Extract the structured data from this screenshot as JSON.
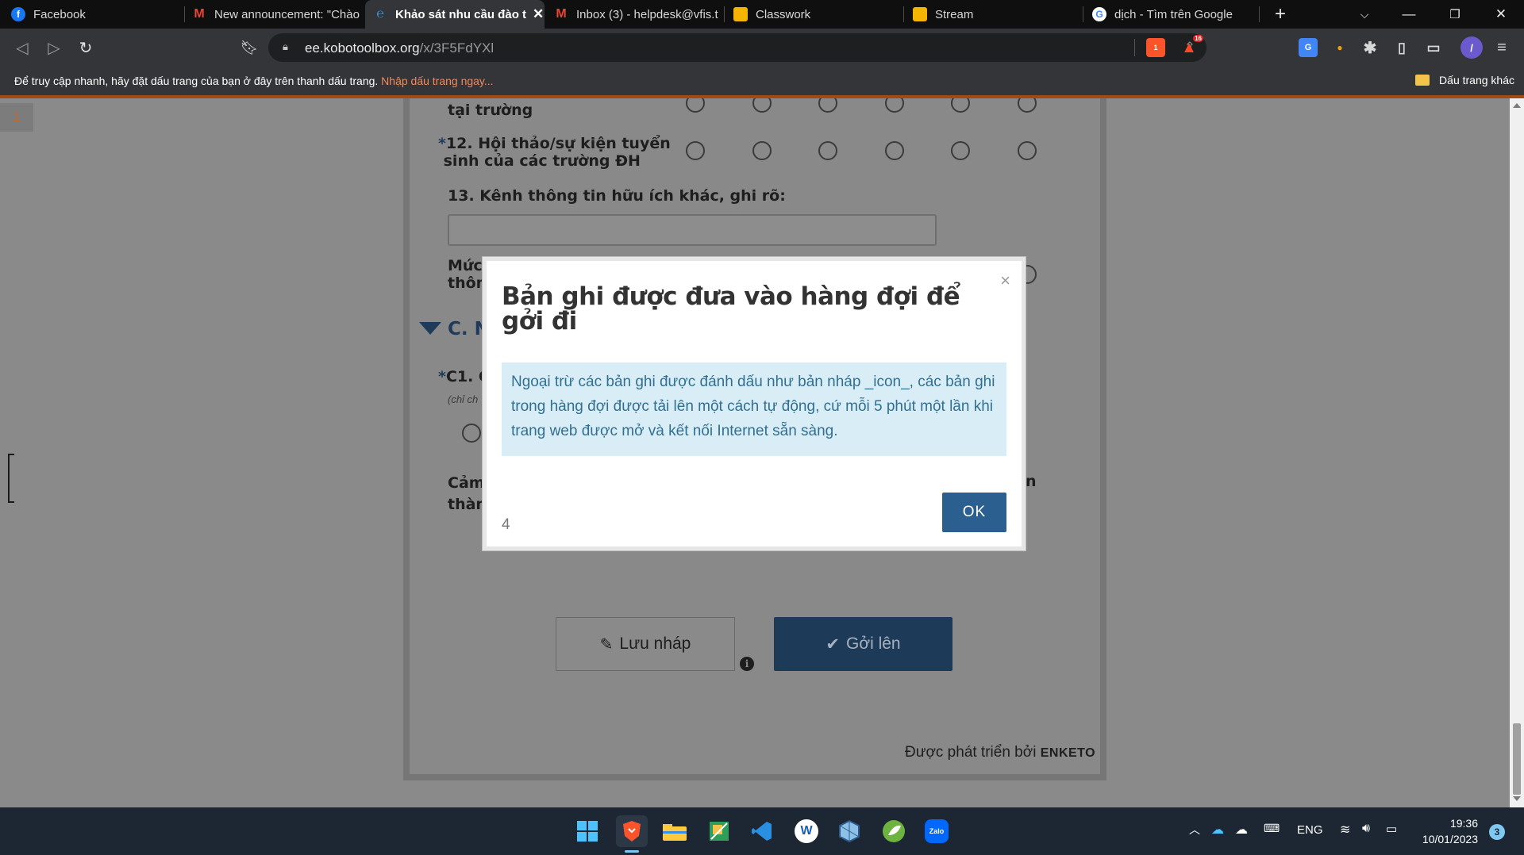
{
  "browser": {
    "tabs": [
      {
        "label": "Facebook",
        "icon": "facebook-icon",
        "color": "#1877f2"
      },
      {
        "label": "New announcement: \"Chào",
        "icon": "gmail-icon",
        "color": "#ea4335"
      },
      {
        "label": "Khảo sát nhu cầu đào t",
        "icon": "kobo-icon",
        "color": "#2095f3",
        "active": true
      },
      {
        "label": "Inbox (3) - helpdesk@vfis.t",
        "icon": "gmail-icon",
        "color": "#ea4335"
      },
      {
        "label": "Classwork",
        "icon": "classroom-icon",
        "color": "#f4b400"
      },
      {
        "label": "Stream",
        "icon": "classroom-icon",
        "color": "#f4b400"
      },
      {
        "label": "dịch - Tìm trên Google",
        "icon": "google-icon",
        "color": "#4285f4"
      }
    ],
    "url_host": "ee.kobotoolbox.org",
    "url_path": "/x/3F5FdYXl",
    "brave_shield_count": "1",
    "rewards_count": "16",
    "bookmarks_prompt": "Để truy cập nhanh, hãy đặt dấu trang của bạn ở đây trên thanh dấu trang.",
    "bookmarks_link": "Nhập dấu trang ngay...",
    "other_bookmarks": "Dấu trang khác"
  },
  "page": {
    "page_number": "1",
    "questions": {
      "q11_tail": "tại trường",
      "q12_line1": "12. Hội thảo/sự kiện tuyển",
      "q12_line2": "sinh của các trường ĐH",
      "q13": "13. Kênh thông tin hữu ích khác, ghi rõ:",
      "partial_muc": "Mức",
      "partial_thon": "thôn",
      "section_c": "C. N",
      "c1": "C1. C",
      "c1_hint": "(chỉ ch",
      "partial_cam": "Cảm",
      "partial_than": "thàn",
      "partial_n": "n"
    },
    "required_mark": "*",
    "save_draft_label": "Lưu nháp",
    "submit_label": "Gởi lên",
    "powered_by": "Được phát triển bởi",
    "powered_brand": "ENKETO"
  },
  "modal": {
    "title": "Bản ghi được đưa vào hàng đợi để gởi đi",
    "message": "Ngoại trừ các bản ghi được đánh dấu như bản nháp _icon_, các bản ghi trong hàng đợi được tải lên một cách tự động, cứ mỗi 5 phút một lần khi trang web được mở và kết nối Internet sẵn sàng.",
    "queue_count": "4",
    "ok_label": "OK",
    "close_symbol": "×"
  },
  "taskbar": {
    "apps": [
      {
        "name": "windows-start",
        "label": ""
      },
      {
        "name": "brave",
        "label": ""
      },
      {
        "name": "file-explorer",
        "label": ""
      },
      {
        "name": "excel-tool",
        "label": ""
      },
      {
        "name": "vscode",
        "label": ""
      },
      {
        "name": "word-app",
        "label": "W"
      },
      {
        "name": "box-app",
        "label": ""
      },
      {
        "name": "spring-app",
        "label": ""
      },
      {
        "name": "zalo",
        "label": "Zalo"
      }
    ],
    "language": "ENG",
    "time": "19:36",
    "date": "10/01/2023",
    "notifications": "3"
  }
}
